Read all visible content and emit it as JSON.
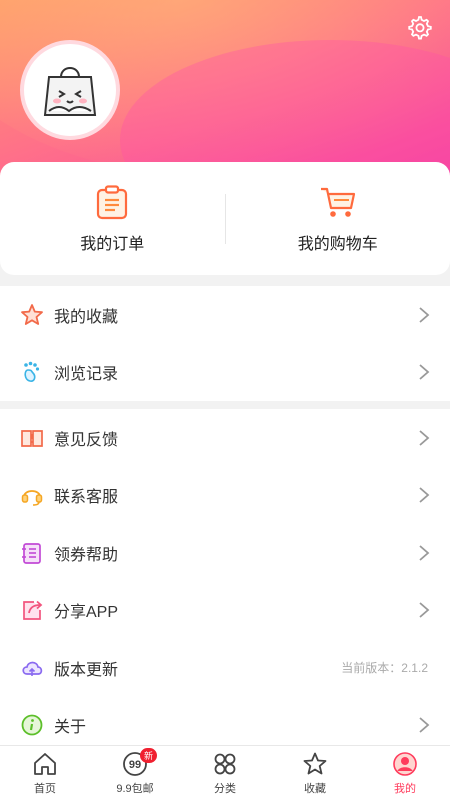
{
  "orders": {
    "my_orders": "我的订单",
    "my_cart": "我的购物车"
  },
  "menu_group1": [
    {
      "label": "我的收藏",
      "icon": "star-icon"
    },
    {
      "label": "浏览记录",
      "icon": "footprint-icon"
    }
  ],
  "menu_group2": [
    {
      "label": "意见反馈",
      "icon": "feedback-book-icon"
    },
    {
      "label": "联系客服",
      "icon": "headset-icon"
    },
    {
      "label": "领券帮助",
      "icon": "coupon-notebook-icon"
    },
    {
      "label": "分享APP",
      "icon": "share-icon"
    },
    {
      "label": "版本更新",
      "icon": "cloud-update-icon",
      "extra": "当前版本：2.1.2"
    },
    {
      "label": "关于",
      "icon": "info-icon"
    }
  ],
  "tabs": [
    {
      "label": "首页",
      "icon": "home-icon"
    },
    {
      "label": "9.9包邮",
      "icon": "nine-nine-icon",
      "badge": "新"
    },
    {
      "label": "分类",
      "icon": "category-icon"
    },
    {
      "label": "收藏",
      "icon": "star-outline-icon"
    },
    {
      "label": "我的",
      "icon": "user-icon",
      "active": true
    }
  ],
  "colors": {
    "accent": "#ff3b5c",
    "header_start": "#ff9a6a",
    "header_end": "#f23aa4"
  }
}
